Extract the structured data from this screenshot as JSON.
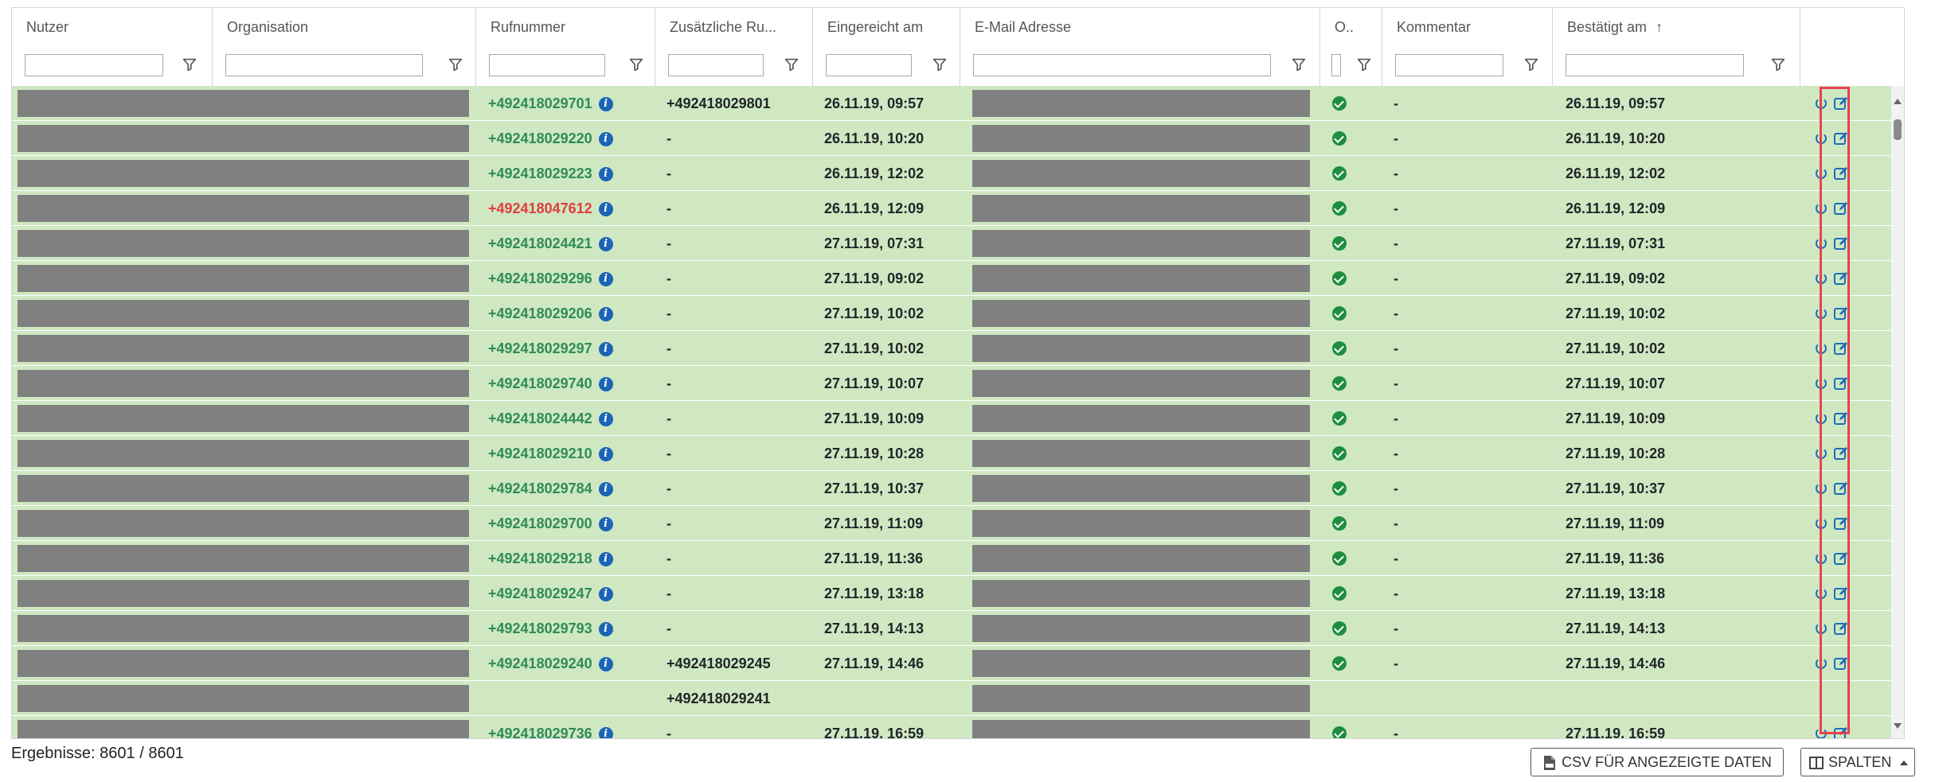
{
  "columns": [
    {
      "label": "Nutzer"
    },
    {
      "label": "Organisation"
    },
    {
      "label": "Rufnummer"
    },
    {
      "label": "Zusätzliche Ru..."
    },
    {
      "label": "Eingereicht am"
    },
    {
      "label": "E-Mail Adresse"
    },
    {
      "label": "O.."
    },
    {
      "label": "Kommentar"
    },
    {
      "label": "Bestätigt am"
    }
  ],
  "sort_indicator": "↑",
  "rows": [
    {
      "phone": "+492418029701",
      "extra": "+492418029801",
      "submitted": "26.11.19, 09:57",
      "comment": "-",
      "confirmed": "26.11.19, 09:57"
    },
    {
      "phone": "+492418029220",
      "extra": "-",
      "submitted": "26.11.19, 10:20",
      "comment": "-",
      "confirmed": "26.11.19, 10:20"
    },
    {
      "phone": "+492418029223",
      "extra": "-",
      "submitted": "26.11.19, 12:02",
      "comment": "-",
      "confirmed": "26.11.19, 12:02"
    },
    {
      "phone": "+492418047612",
      "extra": "-",
      "submitted": "26.11.19, 12:09",
      "comment": "-",
      "confirmed": "26.11.19, 12:09",
      "phone_red": true
    },
    {
      "phone": "+492418024421",
      "extra": "-",
      "submitted": "27.11.19, 07:31",
      "comment": "-",
      "confirmed": "27.11.19, 07:31"
    },
    {
      "phone": "+492418029296",
      "extra": "-",
      "submitted": "27.11.19, 09:02",
      "comment": "-",
      "confirmed": "27.11.19, 09:02"
    },
    {
      "phone": "+492418029206",
      "extra": "-",
      "submitted": "27.11.19, 10:02",
      "comment": "-",
      "confirmed": "27.11.19, 10:02"
    },
    {
      "phone": "+492418029297",
      "extra": "-",
      "submitted": "27.11.19, 10:02",
      "comment": "-",
      "confirmed": "27.11.19, 10:02"
    },
    {
      "phone": "+492418029740",
      "extra": "-",
      "submitted": "27.11.19, 10:07",
      "comment": "-",
      "confirmed": "27.11.19, 10:07"
    },
    {
      "phone": "+492418024442",
      "extra": "-",
      "submitted": "27.11.19, 10:09",
      "comment": "-",
      "confirmed": "27.11.19, 10:09"
    },
    {
      "phone": "+492418029210",
      "extra": "-",
      "submitted": "27.11.19, 10:28",
      "comment": "-",
      "confirmed": "27.11.19, 10:28"
    },
    {
      "phone": "+492418029784",
      "extra": "-",
      "submitted": "27.11.19, 10:37",
      "comment": "-",
      "confirmed": "27.11.19, 10:37"
    },
    {
      "phone": "+492418029700",
      "extra": "-",
      "submitted": "27.11.19, 11:09",
      "comment": "-",
      "confirmed": "27.11.19, 11:09"
    },
    {
      "phone": "+492418029218",
      "extra": "-",
      "submitted": "27.11.19, 11:36",
      "comment": "-",
      "confirmed": "27.11.19, 11:36"
    },
    {
      "phone": "+492418029247",
      "extra": "-",
      "submitted": "27.11.19, 13:18",
      "comment": "-",
      "confirmed": "27.11.19, 13:18"
    },
    {
      "phone": "+492418029793",
      "extra": "-",
      "submitted": "27.11.19, 14:13",
      "comment": "-",
      "confirmed": "27.11.19, 14:13"
    },
    {
      "phone": "+492418029240",
      "extra": "+492418029245",
      "submitted": "27.11.19, 14:46",
      "comment": "-",
      "confirmed": "27.11.19, 14:46"
    },
    {
      "phone": "",
      "extra": "+492418029241",
      "submitted": "",
      "comment": "",
      "confirmed": "",
      "continuation": true
    },
    {
      "phone": "+492418029736",
      "extra": "-",
      "submitted": "27.11.19, 16:59",
      "comment": "-",
      "confirmed": "27.11.19, 16:59"
    }
  ],
  "footer": {
    "results": "Ergebnisse: 8601 / 8601",
    "csv_button": "CSV FÜR ANGEZEIGTE DATEN",
    "columns_button": "SPALTEN"
  },
  "colors": {
    "row_bg": "#cfe8c2",
    "phone_ok": "#2e8b57",
    "phone_error": "#e03c3c",
    "status_ok": "#1e8e3e",
    "action_blue": "#1b6fb7",
    "highlight": "#e8424e"
  },
  "icons": {
    "filter": "filter-icon",
    "info": "info-icon",
    "status": "check-circle-icon",
    "power": "power-icon",
    "edit": "edit-icon",
    "csv": "file-csv-icon",
    "columns": "columns-icon"
  }
}
